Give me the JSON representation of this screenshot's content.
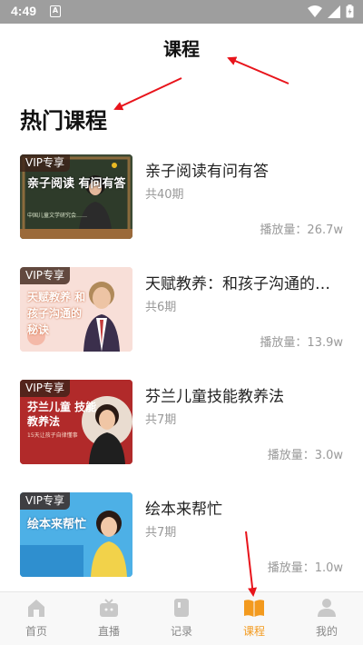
{
  "status_bar": {
    "time": "4:49",
    "notification_icon": "A"
  },
  "header": {
    "title": "课程"
  },
  "section": {
    "title": "热门课程"
  },
  "courses": [
    {
      "title": "亲子阅读有问有答",
      "count": "共40期",
      "plays": "播放量：26.7w",
      "badge": "VIP专享",
      "thumb_text": "亲子阅读 有问有答",
      "thumb_caption": "中国儿童文学研究会……"
    },
    {
      "title": "天赋教养：和孩子沟通的…",
      "count": "共6期",
      "plays": "播放量：13.9w",
      "badge": "VIP专享",
      "thumb_text": "天赋教养 和孩子沟通的 秘诀",
      "thumb_caption": ""
    },
    {
      "title": "芬兰儿童技能教养法",
      "count": "共7期",
      "plays": "播放量：3.0w",
      "badge": "VIP专享",
      "thumb_text": "芬兰儿童 技能教养法",
      "thumb_caption": "15天让孩子自律懂事"
    },
    {
      "title": "绘本来帮忙",
      "count": "共7期",
      "plays": "播放量：1.0w",
      "badge": "VIP专享",
      "thumb_text": "绘本来帮忙",
      "thumb_caption": ""
    }
  ],
  "bottom_nav": [
    {
      "label": "首页",
      "icon": "home-icon",
      "active": false
    },
    {
      "label": "直播",
      "icon": "tv-icon",
      "active": false
    },
    {
      "label": "记录",
      "icon": "record-icon",
      "active": false
    },
    {
      "label": "课程",
      "icon": "book-icon",
      "active": true
    },
    {
      "label": "我的",
      "icon": "profile-icon",
      "active": false
    }
  ],
  "colors": {
    "accent": "#f39a1e",
    "annotation": "#e8141b",
    "statusbar": "#9e9e9e"
  }
}
